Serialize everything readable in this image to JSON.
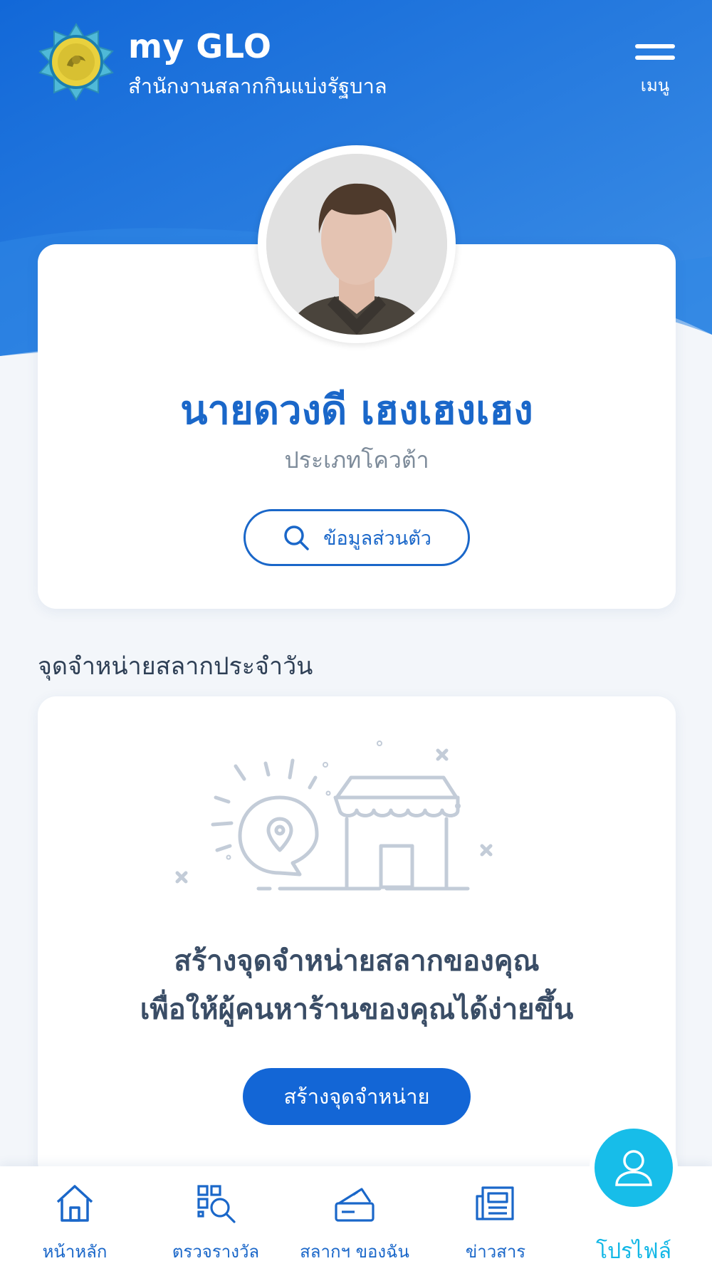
{
  "header": {
    "app_title": "my GLO",
    "app_subtitle": "สำนักงานสลากกินแบ่งรัฐบาล",
    "menu_label": "เมนู",
    "logo_icon": "glo-emblem-icon",
    "menu_icon": "hamburger-icon"
  },
  "profile": {
    "name": "นายดวงดี  เฮงเฮงเฮง",
    "type": "ประเภทโควต้า",
    "info_button": "ข้อมูลส่วนตัว",
    "info_icon": "search-icon",
    "avatar_icon": "user-avatar"
  },
  "store_section": {
    "title": "จุดจำหน่ายสลากประจำวัน",
    "headline_line1": "สร้างจุดจำหน่ายสลากของคุณ",
    "headline_line2": "เพื่อให้ผู้คนหาร้านของคุณได้ง่ายขึ้น",
    "create_button": "สร้างจุดจำหน่าย",
    "illustration_icon": "store-location-illustration"
  },
  "bottom_nav": {
    "items": [
      {
        "label": "หน้าหลัก",
        "icon": "home-icon",
        "active": false
      },
      {
        "label": "ตรวจรางวัล",
        "icon": "qr-search-icon",
        "active": false
      },
      {
        "label": "สลากฯ ของฉัน",
        "icon": "ticket-icon",
        "active": false
      },
      {
        "label": "ข่าวสาร",
        "icon": "newspaper-icon",
        "active": false
      },
      {
        "label": "โปรไฟล์",
        "icon": "profile-icon",
        "active": true
      }
    ]
  },
  "colors": {
    "primary": "#1a67c9",
    "accent": "#17bde9",
    "hero_gradient_start": "#1a6fd9",
    "hero_gradient_end": "#4a9be8",
    "page_background": "#f3f6fa"
  }
}
